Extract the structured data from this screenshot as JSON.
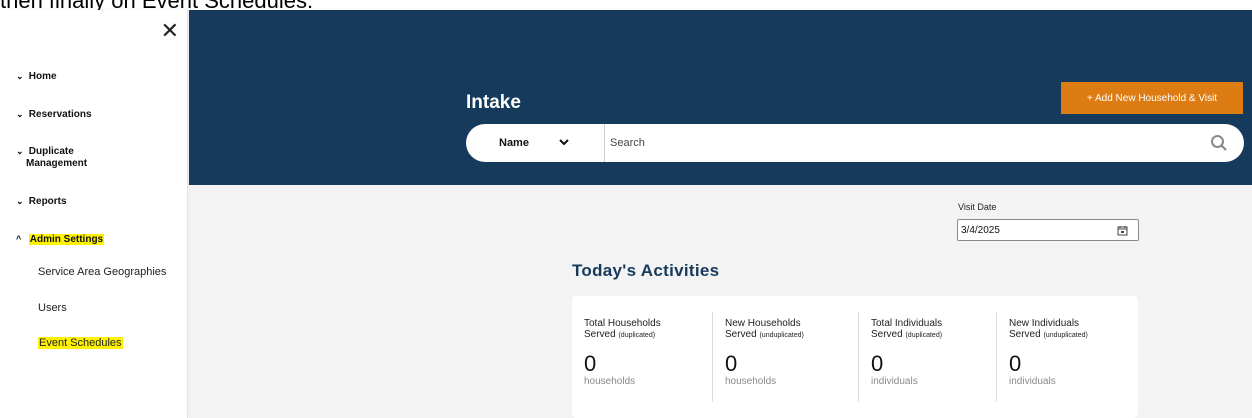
{
  "caption": "then finally on Event Schedules:",
  "sidebar": {
    "items": [
      {
        "label": "Home",
        "expanded": false
      },
      {
        "label": "Reservations",
        "expanded": false
      },
      {
        "label": "Duplicate Management",
        "line1": "Duplicate",
        "line2": "Management",
        "expanded": false
      },
      {
        "label": "Reports",
        "expanded": false
      },
      {
        "label": "Admin Settings",
        "expanded": true
      }
    ],
    "subitems": [
      "Service Area Geographies",
      "Users",
      "Event Schedules"
    ]
  },
  "header": {
    "title": "Intake",
    "add_button": "+ Add New Household & Visit",
    "search_type": "Name",
    "search_placeholder": "Search"
  },
  "main": {
    "visit_date_label": "Visit Date",
    "visit_date_value": "3/4/2025",
    "today_title": "Today's Activities",
    "stats": [
      {
        "line1": "Total Households",
        "line2": "Served",
        "qualifier": "(duplicated)",
        "value": "0",
        "unit": "households"
      },
      {
        "line1": "New Households",
        "line2": "Served",
        "qualifier": "(unduplicated)",
        "value": "0",
        "unit": "households"
      },
      {
        "line1": "Total Individuals",
        "line2": "Served",
        "qualifier": "(duplicated)",
        "value": "0",
        "unit": "individuals"
      },
      {
        "line1": "New Individuals",
        "line2": "Served",
        "qualifier": "(unduplicated)",
        "value": "0",
        "unit": "individuals"
      }
    ]
  },
  "colors": {
    "header_bg": "#163a5c",
    "accent_orange": "#de7c14",
    "highlight": "#fff200",
    "main_bg": "#f3f3f3"
  }
}
